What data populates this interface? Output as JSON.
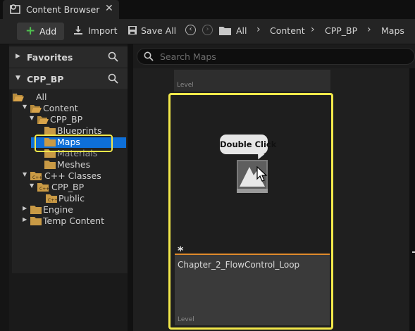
{
  "tab": {
    "title": "Content Browser",
    "close": "✕",
    "icon": "content-browser-icon"
  },
  "toolbar": {
    "add_label": "Add",
    "import_label": "Import",
    "save_all_label": "Save All"
  },
  "breadcrumbs": [
    "All",
    "Content",
    "CPP_BP",
    "Maps"
  ],
  "sidebar": {
    "favorites_title": "Favorites",
    "project_title": "CPP_BP",
    "tree": [
      {
        "label": "All",
        "level": 0
      },
      {
        "label": "Content",
        "level": 1
      },
      {
        "label": "CPP_BP",
        "level": 2
      },
      {
        "label": "Blueprints",
        "level": 3
      },
      {
        "label": "Maps",
        "level": 3,
        "selected": true
      },
      {
        "label": "Materials",
        "level": 3
      },
      {
        "label": "Meshes",
        "level": 3
      },
      {
        "label": "C++ Classes",
        "level": 1
      },
      {
        "label": "CPP_BP",
        "level": 2
      },
      {
        "label": "Public",
        "level": 3
      },
      {
        "label": "Engine",
        "level": 1
      },
      {
        "label": "Temp Content",
        "level": 1
      }
    ]
  },
  "search": {
    "placeholder": "Search Maps"
  },
  "assets": {
    "top_tile_type": "Level",
    "tile_name": "Chapter_2_FlowControl_Loop",
    "tile_type": "Level",
    "tooltip": "Double Click",
    "dirty_marker": "*"
  },
  "colors": {
    "selection": "#0e6fd8",
    "highlight": "#f2e84a",
    "asset_accent": "#e08a2c",
    "add_plus": "#4fc24f"
  }
}
